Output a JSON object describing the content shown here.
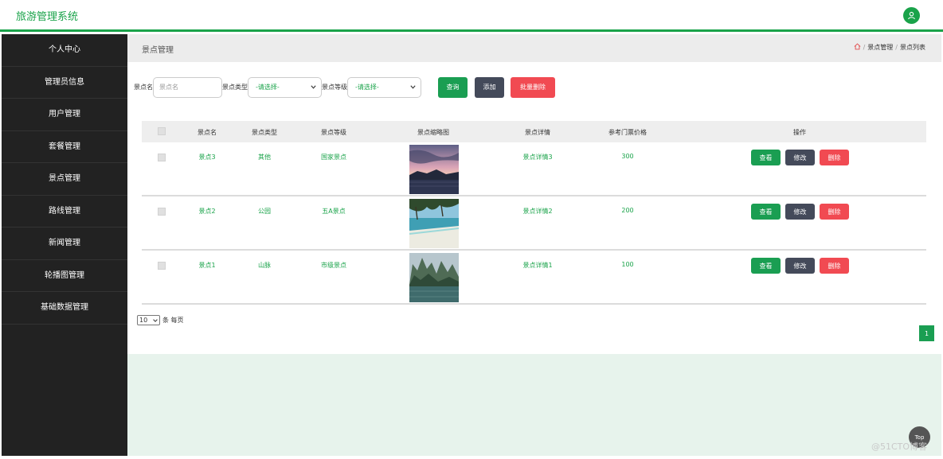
{
  "app": {
    "title": "旅游管理系统"
  },
  "sidebar": {
    "items": [
      {
        "label": "个人中心"
      },
      {
        "label": "管理员信息"
      },
      {
        "label": "用户管理"
      },
      {
        "label": "套餐管理"
      },
      {
        "label": "景点管理"
      },
      {
        "label": "路线管理"
      },
      {
        "label": "新闻管理"
      },
      {
        "label": "轮播图管理"
      },
      {
        "label": "基础数据管理"
      }
    ]
  },
  "breadcrumb": {
    "title": "景点管理",
    "items": [
      "景点管理",
      "景点列表"
    ],
    "separator": "/"
  },
  "search": {
    "name_label": "景点名",
    "name_placeholder": "景点名",
    "type_label": "景点类型",
    "type_value": "-请选择-",
    "level_label": "景点等级",
    "level_value": "-请选择-",
    "query_button": "查询",
    "add_button": "添加",
    "batch_delete_button": "批量删除"
  },
  "table": {
    "headers": [
      "景点名",
      "景点类型",
      "景点等级",
      "景点缩略图",
      "景点详情",
      "参考门票价格",
      "操作"
    ],
    "rows": [
      {
        "name": "景点3",
        "type": "其他",
        "level": "国家景点",
        "image": "sunset-lake",
        "detail": "景点详情3",
        "price": "300"
      },
      {
        "name": "景点2",
        "type": "公园",
        "level": "五A景点",
        "image": "palm-beach",
        "detail": "景点详情2",
        "price": "200"
      },
      {
        "name": "景点1",
        "type": "山脉",
        "level": "市级景点",
        "image": "karst-river",
        "detail": "景点详情1",
        "price": "100"
      }
    ],
    "actions": {
      "view": "查看",
      "edit": "修改",
      "delete": "删除"
    }
  },
  "pagination": {
    "page_size": "10",
    "per_page_label": "条 每页",
    "current_page": "1"
  },
  "to_top": "Top",
  "watermark": "@51CTO博客",
  "colors": {
    "primary": "#1aa34a",
    "dark_button": "#444a5a",
    "danger": "#f14a52",
    "sidebar": "#222222"
  }
}
